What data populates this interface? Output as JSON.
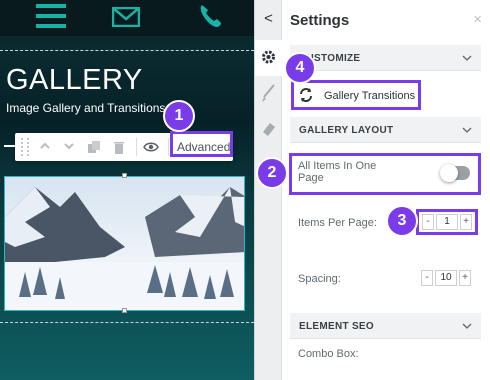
{
  "canvas": {
    "nav_icons": [
      "menu-icon",
      "mail-icon",
      "phone-icon"
    ],
    "gallery_title": "GALLERY",
    "gallery_subtitle": "Image Gallery and Transitions.",
    "toolbar": {
      "icons": [
        "drag-handle-icon",
        "chevron-up-icon",
        "chevron-down-icon",
        "copy-icon",
        "trash-icon",
        "visibility-icon"
      ],
      "advanced_label": "Advanced"
    }
  },
  "panel": {
    "title": "Settings",
    "close_glyph": "×",
    "back_glyph": "<",
    "rail_tabs": [
      "gear-icon",
      "brush-icon",
      "eraser-icon"
    ],
    "sections": {
      "customize": "CUSTOMIZE",
      "gallery_layout": "GALLERY LAYOUT",
      "element_seo": "ELEMENT SEO"
    },
    "gallery_transitions": "Gallery Transitions",
    "all_items_label": "All Items In One Page",
    "all_items_toggle": false,
    "items_per_page_label": "Items Per Page:",
    "items_per_page_value": "1",
    "spacing_label": "Spacing:",
    "spacing_value": "10",
    "combo_box_label": "Combo Box:",
    "stepper_minus": "-",
    "stepper_plus": "+"
  },
  "callouts": [
    "1",
    "2",
    "3",
    "4"
  ],
  "colors": {
    "callout": "#7a3ce8",
    "accent_teal": "#17b3a6",
    "canvas_bg": "#0a3a3f"
  }
}
